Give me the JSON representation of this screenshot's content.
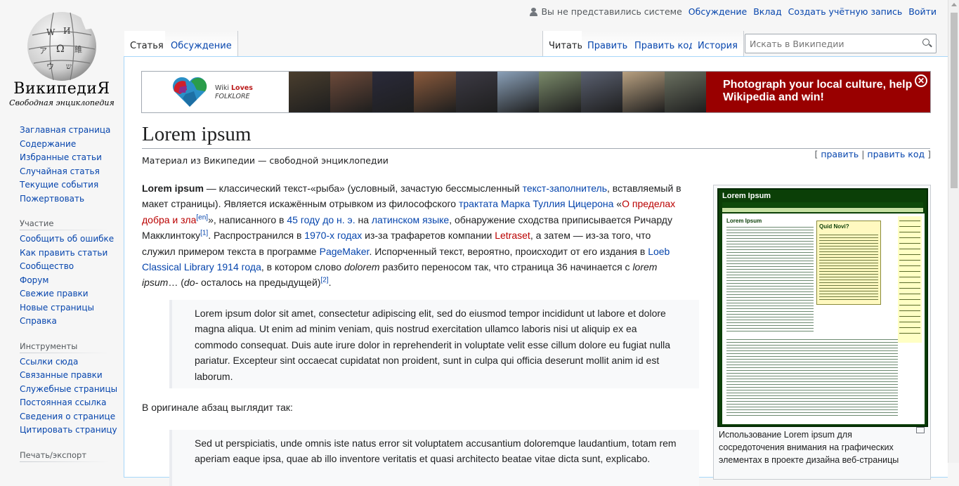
{
  "logo": {
    "wordmark": "ВикипедиЯ",
    "tagline": "Свободная энциклопедия"
  },
  "personal": {
    "not_logged_in": "Вы не представились системе",
    "links": [
      "Обсуждение",
      "Вклад",
      "Создать учётную запись",
      "Войти"
    ]
  },
  "tabs": {
    "left": [
      "Статья",
      "Обсуждение"
    ],
    "right": [
      "Читать",
      "Править",
      "Править код",
      "История"
    ]
  },
  "search": {
    "placeholder": "Искать в Википедии"
  },
  "sidebar": {
    "nav": [
      "Заглавная страница",
      "Содержание",
      "Избранные статьи",
      "Случайная статья",
      "Текущие события",
      "Пожертвовать"
    ],
    "participation": {
      "heading": "Участие",
      "items": [
        "Сообщить об ошибке",
        "Как править статьи",
        "Сообщество",
        "Форум",
        "Свежие правки",
        "Новые страницы",
        "Справка"
      ]
    },
    "tools": {
      "heading": "Инструменты",
      "items": [
        "Ссылки сюда",
        "Связанные правки",
        "Служебные страницы",
        "Постоянная ссылка",
        "Сведения о странице",
        "Цитировать страницу"
      ]
    },
    "next_heading": "Печать/экспорт"
  },
  "banner": {
    "logo_line1": "Wiki",
    "logo_line1_bold": "Loves",
    "logo_line2": "FOLKLORE",
    "message": "Photograph your local culture, help Wikipedia and win!",
    "photo_colors": [
      "#4a3e2e",
      "#6d4a3a",
      "#2a2a3a",
      "#8a5a3c",
      "#3c3a44",
      "#8aa0b8",
      "#7a8a6a",
      "#5a6070",
      "#b8a080",
      "#6a7060"
    ]
  },
  "article": {
    "title": "Lorem ipsum",
    "edit_links": [
      "править",
      "править код"
    ],
    "subtitle": "Материал из Википедии — свободной энциклопедии",
    "lead": {
      "bold": "Lorem ipsum",
      "t1": " — классический текст-«рыба» (условный, зачастую бессмысленный ",
      "l1": "текст-заполнитель",
      "t2": ", вставляемый в макет страницы). Является искажённым отрывком из философского ",
      "l2": "трактата Марка Туллия Цицерона",
      "t3": " «",
      "l3": "О пределах добра и зла",
      "ref1": "[en]",
      "t4": "», написанного в ",
      "l4": "45 году до н. э.",
      "t5": " на ",
      "l5": "латинском языке",
      "t6": ", обнаружение сходства приписывается Ричарду Макклинтоку",
      "ref2": "[1]",
      "t7": ". Распространился в ",
      "l6": "1970-х годах",
      "t8": " из-за трафаретов компании ",
      "l7": "Letraset",
      "t9": ", а затем — из-за того, что служил примером текста в программе ",
      "l8": "PageMaker",
      "t10": ". Испорченный текст, вероятно, происходит от его издания в ",
      "l9": "Loeb Classical Library 1914 года",
      "t11": ", в котором слово ",
      "i1": "dolorem",
      "t12": " разбито переносом так, что страница 36 начинается с ",
      "i2": "lorem ipsum",
      "t13": "… (",
      "i3": "do-",
      "t14": " осталось на предыдущей)",
      "ref3": "[2]",
      "t15": "."
    },
    "quote1": "Lorem ipsum dolor sit amet, consectetur adipiscing elit, sed do eiusmod tempor incididunt ut labore et dolore magna aliqua. Ut enim ad minim veniam, quis nostrud exercitation ullamco laboris nisi ut aliquip ex ea commodo consequat. Duis aute irure dolor in reprehenderit in voluptate velit esse cillum dolore eu fugiat nulla pariatur. Excepteur sint occaecat cupidatat non proident, sunt in culpa qui officia deserunt mollit anim id est laborum.",
    "original_intro": "В оригинале абзац выглядит так:",
    "quote2": "Sed ut perspiciatis, unde omnis iste natus error sit voluptatem accusantium doloremque laudantium, totam rem aperiam eaque ipsa, quae ab illo inventore veritatis et quasi architecto beatae vitae dicta sunt, explicabo."
  },
  "thumb": {
    "mock_title": "Lorem Ipsum",
    "mock_box1": "Lorem Ipsum",
    "mock_box2": "Quid Novi?",
    "caption": "Использование Lorem ipsum для сосредоточения внимания на графических элементах в проекте дизайна веб-страницы"
  }
}
